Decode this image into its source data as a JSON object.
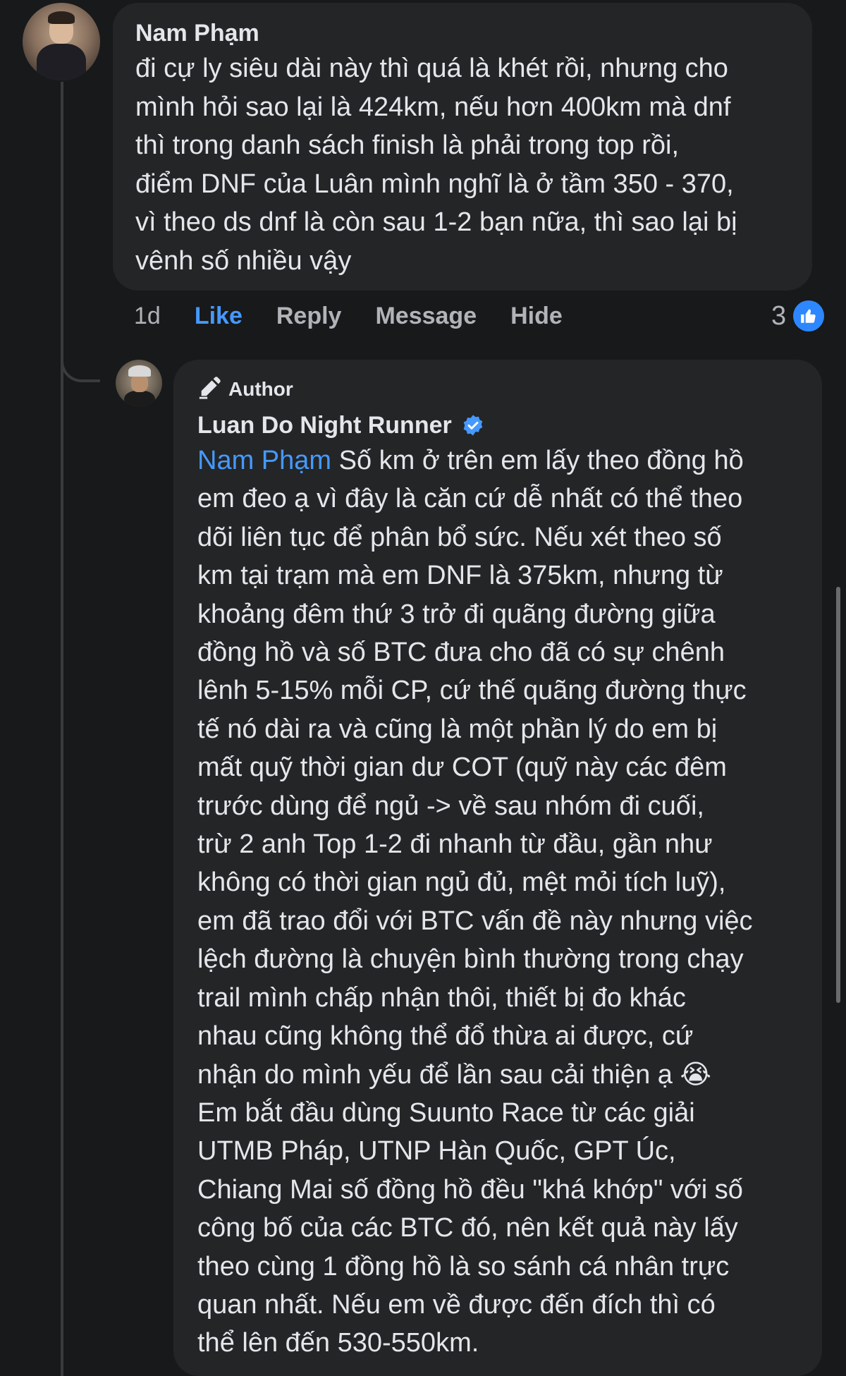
{
  "comment": {
    "author": "Nam Phạm",
    "text": "đi cự ly siêu dài này thì quá là khét rồi, nhưng cho\nmình hỏi sao lại là 424km, nếu hơn 400km mà dnf\nthì trong danh sách finish là phải trong top rồi,\nđiểm DNF của Luân mình nghĩ là ở tầm 350 - 370,\nvì theo ds dnf là còn sau 1-2 bạn nữa, thì sao lại bị\nvênh số nhiều vậy",
    "avatar_icon": "profile-photo"
  },
  "actions": {
    "time": "1d",
    "like": "Like",
    "reply": "Reply",
    "message": "Message",
    "hide": "Hide",
    "reaction_count": "3",
    "reaction_icon": "thumbs-up-icon"
  },
  "reply": {
    "badge_label": "Author",
    "badge_icon": "pencil-icon",
    "author": "Luan Do Night Runner",
    "verified_icon": "verified-badge-icon",
    "mention": "Nam Phạm",
    "text": " Số km ở trên em lấy theo đồng hồ\nem đeo ạ vì đây là căn cứ dễ nhất có thể theo\ndõi liên tục để phân bổ sức. Nếu xét theo số\nkm tại trạm mà em DNF là 375km, nhưng từ\nkhoảng đêm thứ 3 trở đi quãng đường giữa\nđồng hồ và số BTC đưa cho đã có sự chênh\nlênh 5-15% mỗi CP, cứ thế quãng đường thực\ntế nó dài ra và cũng là một phần lý do em bị\nmất quỹ thời gian dư COT (quỹ này các đêm\ntrước dùng để ngủ -> về sau nhóm đi cuối,\ntrừ 2 anh Top 1-2 đi nhanh từ đầu, gần như\nkhông có thời gian ngủ đủ, mệt mỏi tích luỹ),\nem đã trao đổi với BTC vấn đề này nhưng việc\nlệch đường là chuyện bình thường trong chạy\ntrail mình chấp nhận thôi, thiết bị đo khác\nnhau cũng không thể đổ thừa ai được, cứ\nnhận do mình yếu để lần sau cải thiện ạ 😭\nEm bắt đầu dùng Suunto Race từ các giải\nUTMB Pháp, UTNP Hàn Quốc, GPT Úc,\nChiang Mai số đồng hồ đều \"khá khớp\" với số\ncông bố của các BTC đó, nên kết quả này lấy\ntheo cùng 1 đồng hồ là so sánh cá nhân trực\nquan nhất. Nếu em về được đến đích thì có\nthể lên đến 530-550km."
  },
  "colors": {
    "background": "#18191a",
    "bubble": "#242526",
    "text": "#e4e6eb",
    "secondary_text": "#b0b3b8",
    "accent_blue": "#4599ff",
    "like_badge": "#2d88ff"
  }
}
